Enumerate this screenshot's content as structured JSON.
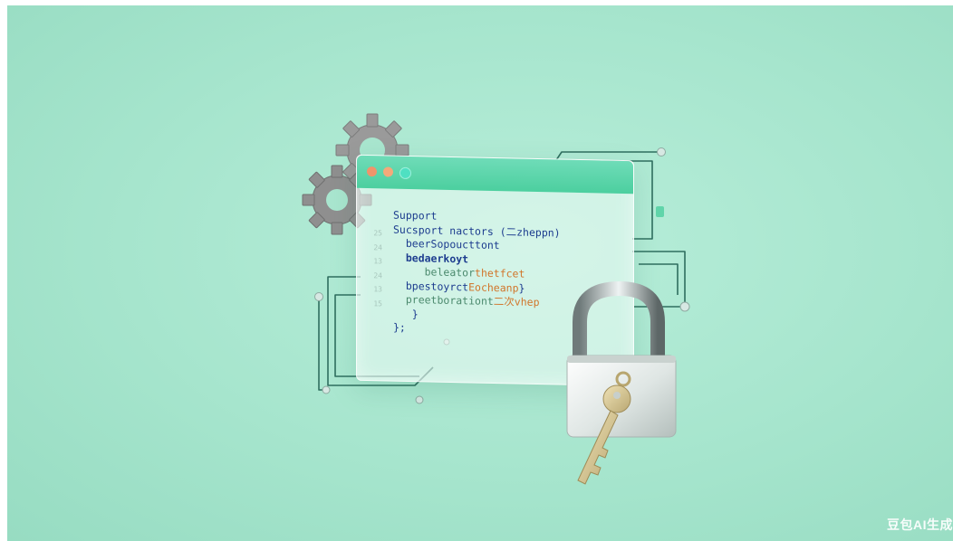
{
  "illustration": {
    "subject": "code window with gears, padlock and key",
    "colors": {
      "background": "#a6e5cd",
      "accent": "#4ccf9f",
      "code_blue": "#1d3d8f",
      "code_orange": "#d1762b"
    },
    "icons": [
      "gear-icon",
      "padlock-icon",
      "key-icon"
    ]
  },
  "code_window": {
    "line_numbers": [
      "25",
      "24",
      "13",
      "24",
      "13",
      "15"
    ],
    "lines": {
      "l1": "Support",
      "l2a": "Sucsport nactors ",
      "l2b": "(二zheppn)",
      "l3": "beerSopoucttont",
      "l4": "bedaerkoyt",
      "l5a": "beleator",
      "l5b": "thetfcet",
      "l6a": "bpestoyrct",
      "l6b": "Eocheanp",
      "l6c": "}",
      "l7a": "preetborationt",
      "l7b": "二次vhep",
      "l8": "}",
      "l9": "};"
    }
  },
  "watermark": "豆包AI生成"
}
